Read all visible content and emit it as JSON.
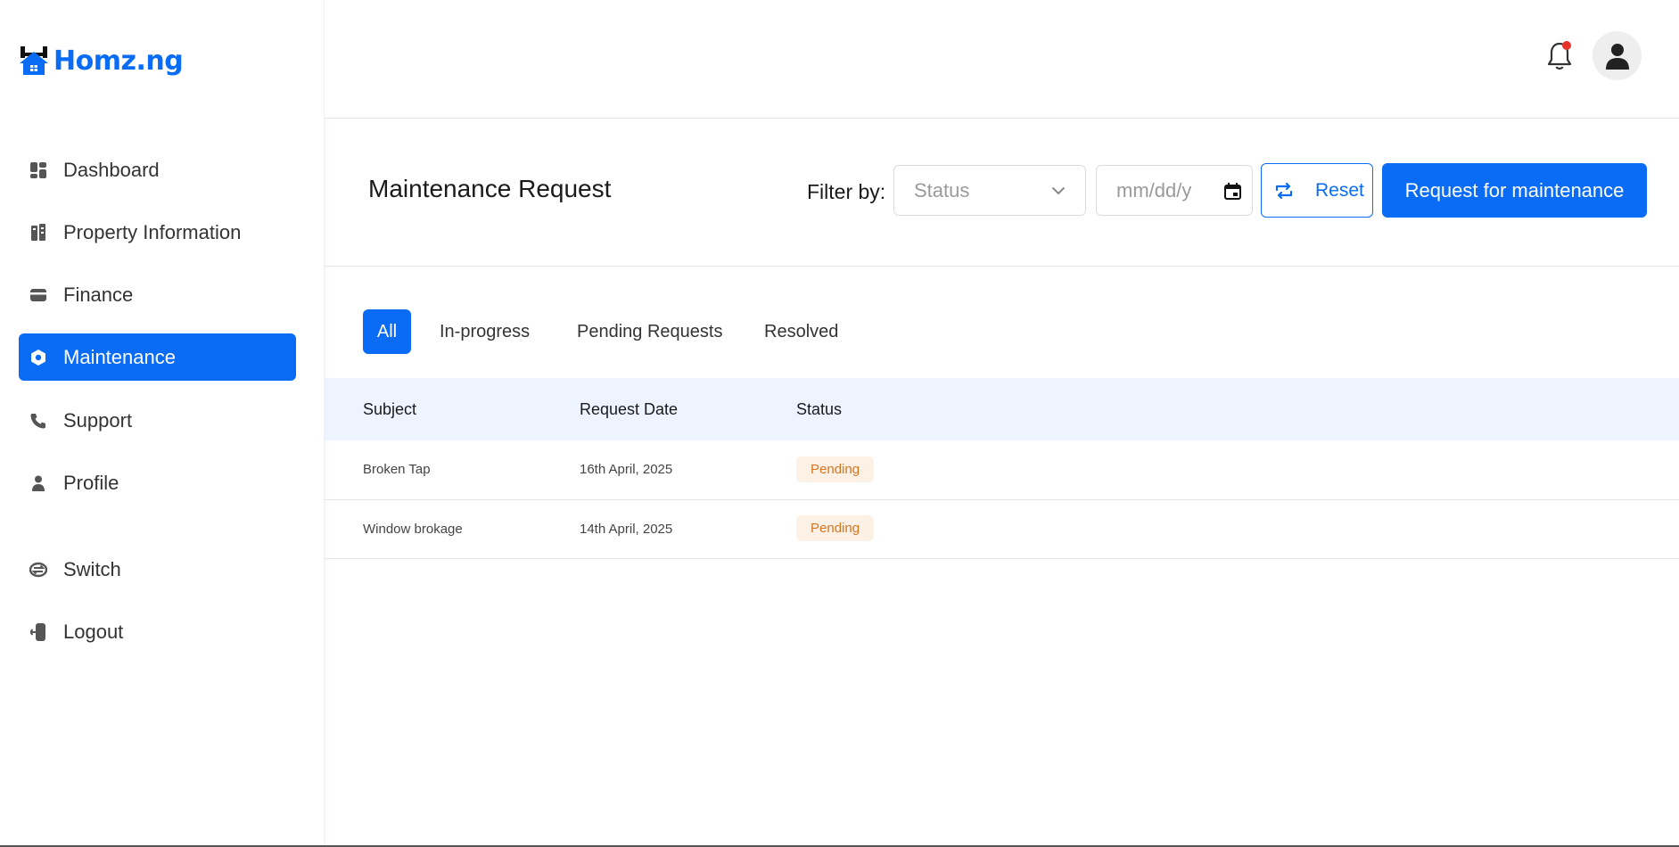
{
  "brand": {
    "name": "Homz.ng",
    "accent": "#0a6cf5"
  },
  "sidebar": {
    "items": [
      {
        "label": "Dashboard",
        "icon": "dashboard-icon"
      },
      {
        "label": "Property Information",
        "icon": "building-icon"
      },
      {
        "label": "Finance",
        "icon": "wallet-icon"
      },
      {
        "label": "Maintenance",
        "icon": "maintenance-icon",
        "active": true
      },
      {
        "label": "Support",
        "icon": "phone-icon"
      },
      {
        "label": "Profile",
        "icon": "person-icon"
      },
      {
        "label": "Switch",
        "icon": "switch-icon"
      },
      {
        "label": "Logout",
        "icon": "logout-icon"
      }
    ]
  },
  "header": {
    "notifications_icon": "bell-icon",
    "avatar_icon": "user-icon",
    "notification_dot_color": "#e5322b"
  },
  "page": {
    "title": "Maintenance Request",
    "filter_label": "Filter by:",
    "status_placeholder": "Status",
    "date_placeholder": "mm/dd/y",
    "reset_label": "Reset",
    "request_label": "Request for maintenance"
  },
  "tabs": [
    {
      "label": "All",
      "active": true
    },
    {
      "label": "In-progress"
    },
    {
      "label": "Pending Requests"
    },
    {
      "label": "Resolved"
    }
  ],
  "table": {
    "columns": [
      "Subject",
      "Request Date",
      "Status"
    ],
    "rows": [
      {
        "subject": "Broken Tap",
        "date": "16th April, 2025",
        "status": "Pending"
      },
      {
        "subject": "Window brokage",
        "date": "14th April, 2025",
        "status": "Pending"
      }
    ],
    "status_colors": {
      "Pending": {
        "bg": "#fdf1e6",
        "fg": "#d8741c"
      }
    }
  }
}
